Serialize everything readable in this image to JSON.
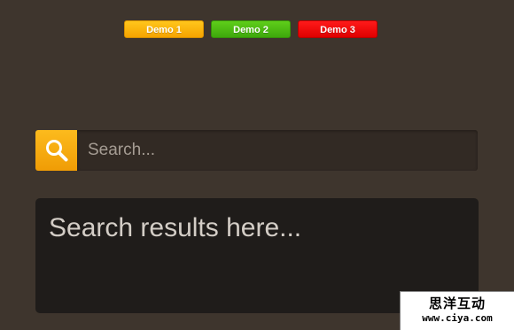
{
  "demo_nav": {
    "buttons": [
      {
        "label": "Demo 1",
        "color": "#f7aa0b"
      },
      {
        "label": "Demo 2",
        "color": "#47b510"
      },
      {
        "label": "Demo 3",
        "color": "#ee0505"
      }
    ]
  },
  "search": {
    "placeholder": "Search...",
    "value": "",
    "icon": "search-icon",
    "button_color": "#f5a80e"
  },
  "results": {
    "text": "Search results here..."
  },
  "watermark": {
    "name": "思洋互动",
    "url": "www.ciya.com"
  }
}
